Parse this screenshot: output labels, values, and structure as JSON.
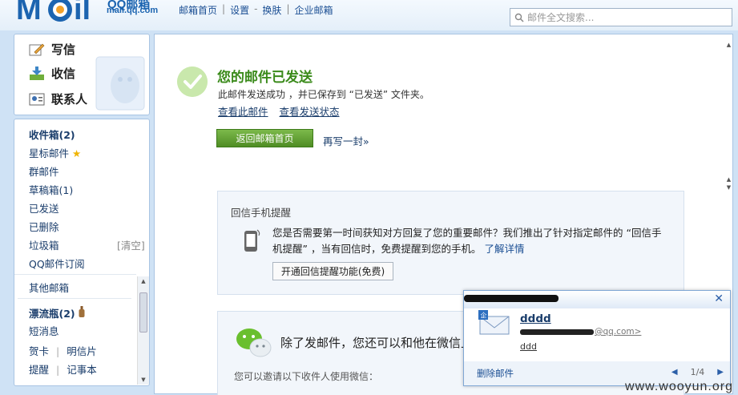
{
  "header": {
    "logo_text": "QQ邮箱",
    "logo_url": "mail.qq.com",
    "nav": [
      "邮箱首页",
      "设置",
      "换肤",
      "企业邮箱"
    ],
    "nav_dash": "-",
    "search_placeholder": "邮件全文搜索..."
  },
  "sidebar": {
    "actions": [
      {
        "label": "写信",
        "icon": "compose-icon"
      },
      {
        "label": "收信",
        "icon": "inbox-download-icon"
      },
      {
        "label": "联系人",
        "icon": "contacts-icon"
      }
    ],
    "folders": {
      "inbox": "收件箱(2)",
      "starred": "星标邮件",
      "group": "群邮件",
      "drafts": "草稿箱(1)",
      "sent": "已发送",
      "deleted": "已删除",
      "trash": "垃圾箱",
      "trash_clear": "[清空]",
      "subscription": "QQ邮件订阅",
      "other": "其他邮箱",
      "drift": "漂流瓶(2)",
      "sms": "短消息",
      "card": "贺卡",
      "postcard": "明信片",
      "reminder": "提醒",
      "notebook": "记事本"
    }
  },
  "main": {
    "title": "您的邮件已发送",
    "desc": "此邮件发送成功 ，并已保存到 “已发送” 文件夹。",
    "link_view": "查看此邮件",
    "link_status": "查看发送状态",
    "return_btn": "返回邮箱首页",
    "rewrite": "再写一封»",
    "remind": {
      "title": "回信手机提醒",
      "text": "您是否需要第一时间获知对方回复了您的重要邮件？我们推出了针对指定邮件的 “回信手机提醒” ，当有回信时，免费提醒到您的手机。",
      "more": "了解详情",
      "button": "开通回信提醒功能(免费)"
    },
    "wechat": {
      "text": "除了发邮件，您还可以和他在微信上",
      "sub": "您可以邀请以下收件人使用微信："
    }
  },
  "popup": {
    "subject": "dddd",
    "from_suffix": "@qq.com>",
    "body": "ddd",
    "delete": "删除邮件",
    "page": "1/4",
    "close": "✕"
  },
  "watermark": "www.wooyun.org",
  "colors": {
    "accent_green": "#3a8a1a",
    "link_blue": "#1a4e93",
    "frame_blue": "#a9c4e3"
  }
}
